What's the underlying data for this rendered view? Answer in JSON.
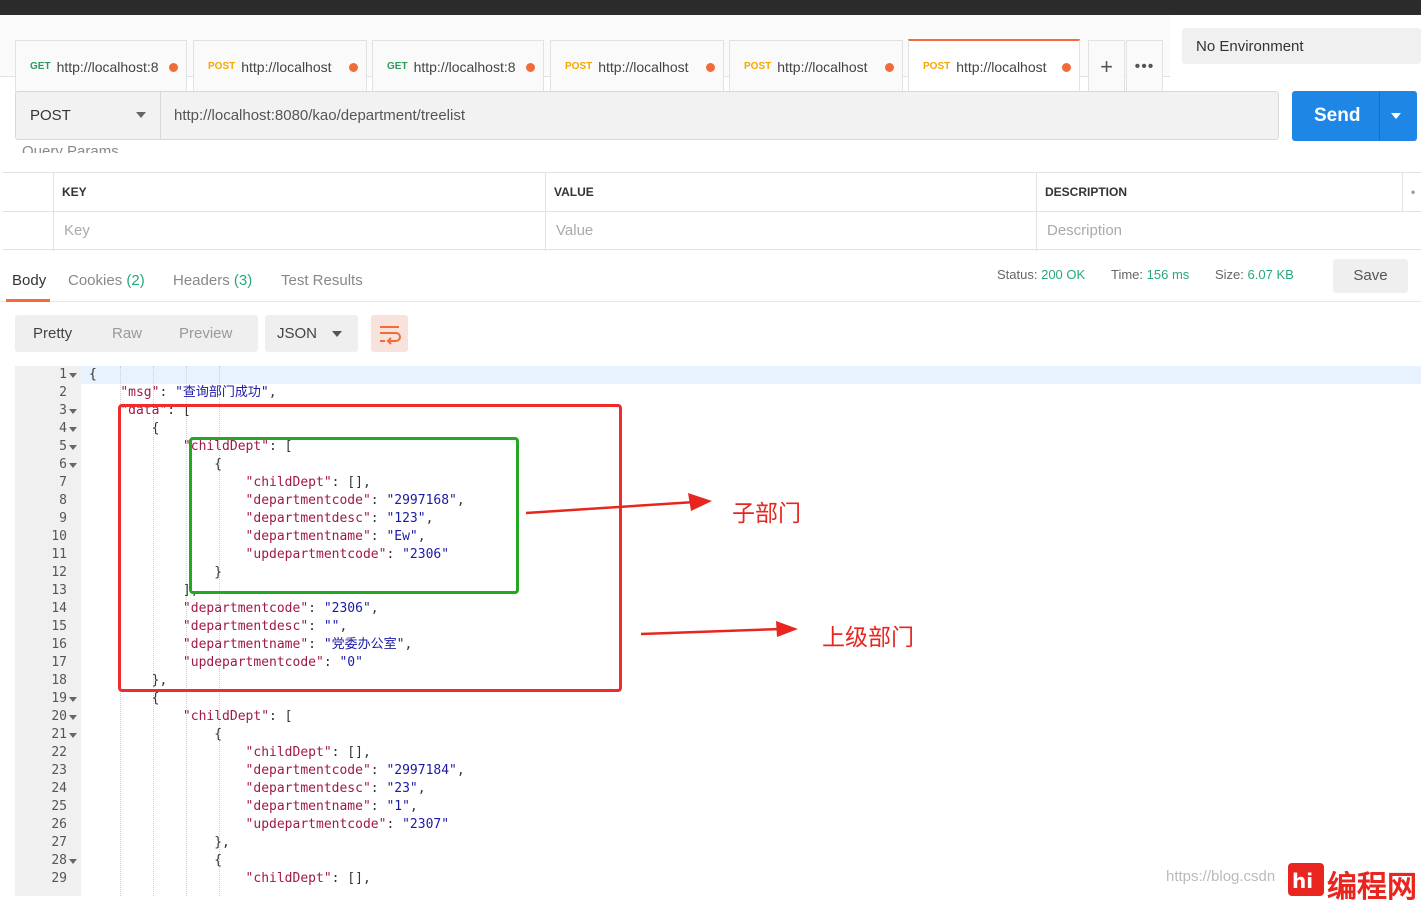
{
  "tabs": [
    {
      "method": "GET",
      "url": "http://localhost:8"
    },
    {
      "method": "POST",
      "url": "http://localhost"
    },
    {
      "method": "GET",
      "url": "http://localhost:8"
    },
    {
      "method": "POST",
      "url": "http://localhost"
    },
    {
      "method": "POST",
      "url": "http://localhost"
    },
    {
      "method": "POST",
      "url": "http://localhost"
    }
  ],
  "environment": "No Environment",
  "request": {
    "method": "POST",
    "url": "http://localhost:8080/kao/department/treelist",
    "send_label": "Send"
  },
  "params": {
    "title": "Query Params",
    "headers": [
      "KEY",
      "VALUE",
      "DESCRIPTION"
    ],
    "placeholders": [
      "Key",
      "Value",
      "Description"
    ]
  },
  "response_tabs": {
    "body": "Body",
    "cookies": "Cookies",
    "cookies_count": "(2)",
    "headers": "Headers",
    "headers_count": "(3)",
    "tests": "Test Results"
  },
  "status": {
    "status_label": "Status:",
    "status_value": "200 OK",
    "time_label": "Time:",
    "time_value": "156 ms",
    "size_label": "Size:",
    "size_value": "6.07 KB",
    "save_label": "Save"
  },
  "view": {
    "pretty": "Pretty",
    "raw": "Raw",
    "preview": "Preview",
    "format": "JSON"
  },
  "code_lines": [
    {
      "n": "1",
      "fold": true,
      "text": "{"
    },
    {
      "n": "2",
      "fold": false,
      "text": "    \"msg\": \"查询部门成功\","
    },
    {
      "n": "3",
      "fold": true,
      "text": "    \"data\": ["
    },
    {
      "n": "4",
      "fold": true,
      "text": "        {"
    },
    {
      "n": "5",
      "fold": true,
      "text": "            \"childDept\": ["
    },
    {
      "n": "6",
      "fold": true,
      "text": "                {"
    },
    {
      "n": "7",
      "fold": false,
      "text": "                    \"childDept\": [],"
    },
    {
      "n": "8",
      "fold": false,
      "text": "                    \"departmentcode\": \"2997168\","
    },
    {
      "n": "9",
      "fold": false,
      "text": "                    \"departmentdesc\": \"123\","
    },
    {
      "n": "10",
      "fold": false,
      "text": "                    \"departmentname\": \"Ew\","
    },
    {
      "n": "11",
      "fold": false,
      "text": "                    \"updepartmentcode\": \"2306\""
    },
    {
      "n": "12",
      "fold": false,
      "text": "                }"
    },
    {
      "n": "13",
      "fold": false,
      "text": "            ],"
    },
    {
      "n": "14",
      "fold": false,
      "text": "            \"departmentcode\": \"2306\","
    },
    {
      "n": "15",
      "fold": false,
      "text": "            \"departmentdesc\": \"\","
    },
    {
      "n": "16",
      "fold": false,
      "text": "            \"departmentname\": \"党委办公室\","
    },
    {
      "n": "17",
      "fold": false,
      "text": "            \"updepartmentcode\": \"0\""
    },
    {
      "n": "18",
      "fold": false,
      "text": "        },"
    },
    {
      "n": "19",
      "fold": true,
      "text": "        {"
    },
    {
      "n": "20",
      "fold": true,
      "text": "            \"childDept\": ["
    },
    {
      "n": "21",
      "fold": true,
      "text": "                {"
    },
    {
      "n": "22",
      "fold": false,
      "text": "                    \"childDept\": [],"
    },
    {
      "n": "23",
      "fold": false,
      "text": "                    \"departmentcode\": \"2997184\","
    },
    {
      "n": "24",
      "fold": false,
      "text": "                    \"departmentdesc\": \"23\","
    },
    {
      "n": "25",
      "fold": false,
      "text": "                    \"departmentname\": \"1\","
    },
    {
      "n": "26",
      "fold": false,
      "text": "                    \"updepartmentcode\": \"2307\""
    },
    {
      "n": "27",
      "fold": false,
      "text": "                },"
    },
    {
      "n": "28",
      "fold": true,
      "text": "                {"
    },
    {
      "n": "29",
      "fold": false,
      "text": "                    \"childDept\": [],"
    }
  ],
  "annotations": {
    "child": "子部门",
    "parent": "上级部门"
  },
  "watermark": "https://blog.csdn",
  "logo_text": "编程网"
}
